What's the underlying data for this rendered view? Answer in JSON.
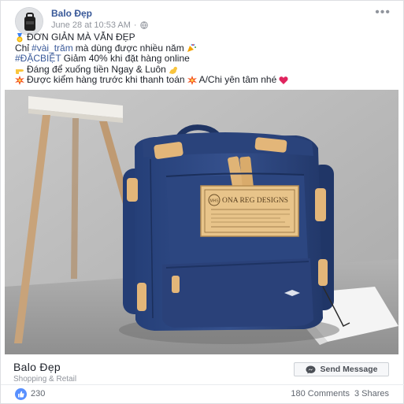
{
  "post": {
    "page_name": "Balo Đẹp",
    "timestamp": "June 28 at 10:53 AM",
    "separator": "·",
    "more_label": "•••",
    "lines": [
      {
        "text": "ĐƠN GIẢN MÀ VẪN ĐẸP"
      },
      {
        "pre": "Chỉ ",
        "hashtag": "#vài_trăm",
        "post": " mà dùng được nhiều năm"
      },
      {
        "hashtag": "#ĐẶCBIỆT",
        "post": " Giảm 40% khi đặt hàng online"
      },
      {
        "text": "Đáng để xuống tiền Ngay & Luôn"
      },
      {
        "text": "Được kiểm hàng trước khi thanh toán",
        "text2": "A/Chi yên tâm nhé"
      }
    ],
    "patch_text": "ONA REG DESIGNS",
    "patch_badge": "MHS"
  },
  "card": {
    "name": "Balo Đẹp",
    "category": "Shopping & Retail",
    "send_label": "Send Message"
  },
  "stats": {
    "likes": "230",
    "comments": "180 Comments",
    "shares": "3 Shares"
  },
  "colors": {
    "link": "#385898",
    "like": "#5890ff",
    "bag": "#2f4a86",
    "leather": "#e3b679",
    "heart": "#e0245e"
  }
}
